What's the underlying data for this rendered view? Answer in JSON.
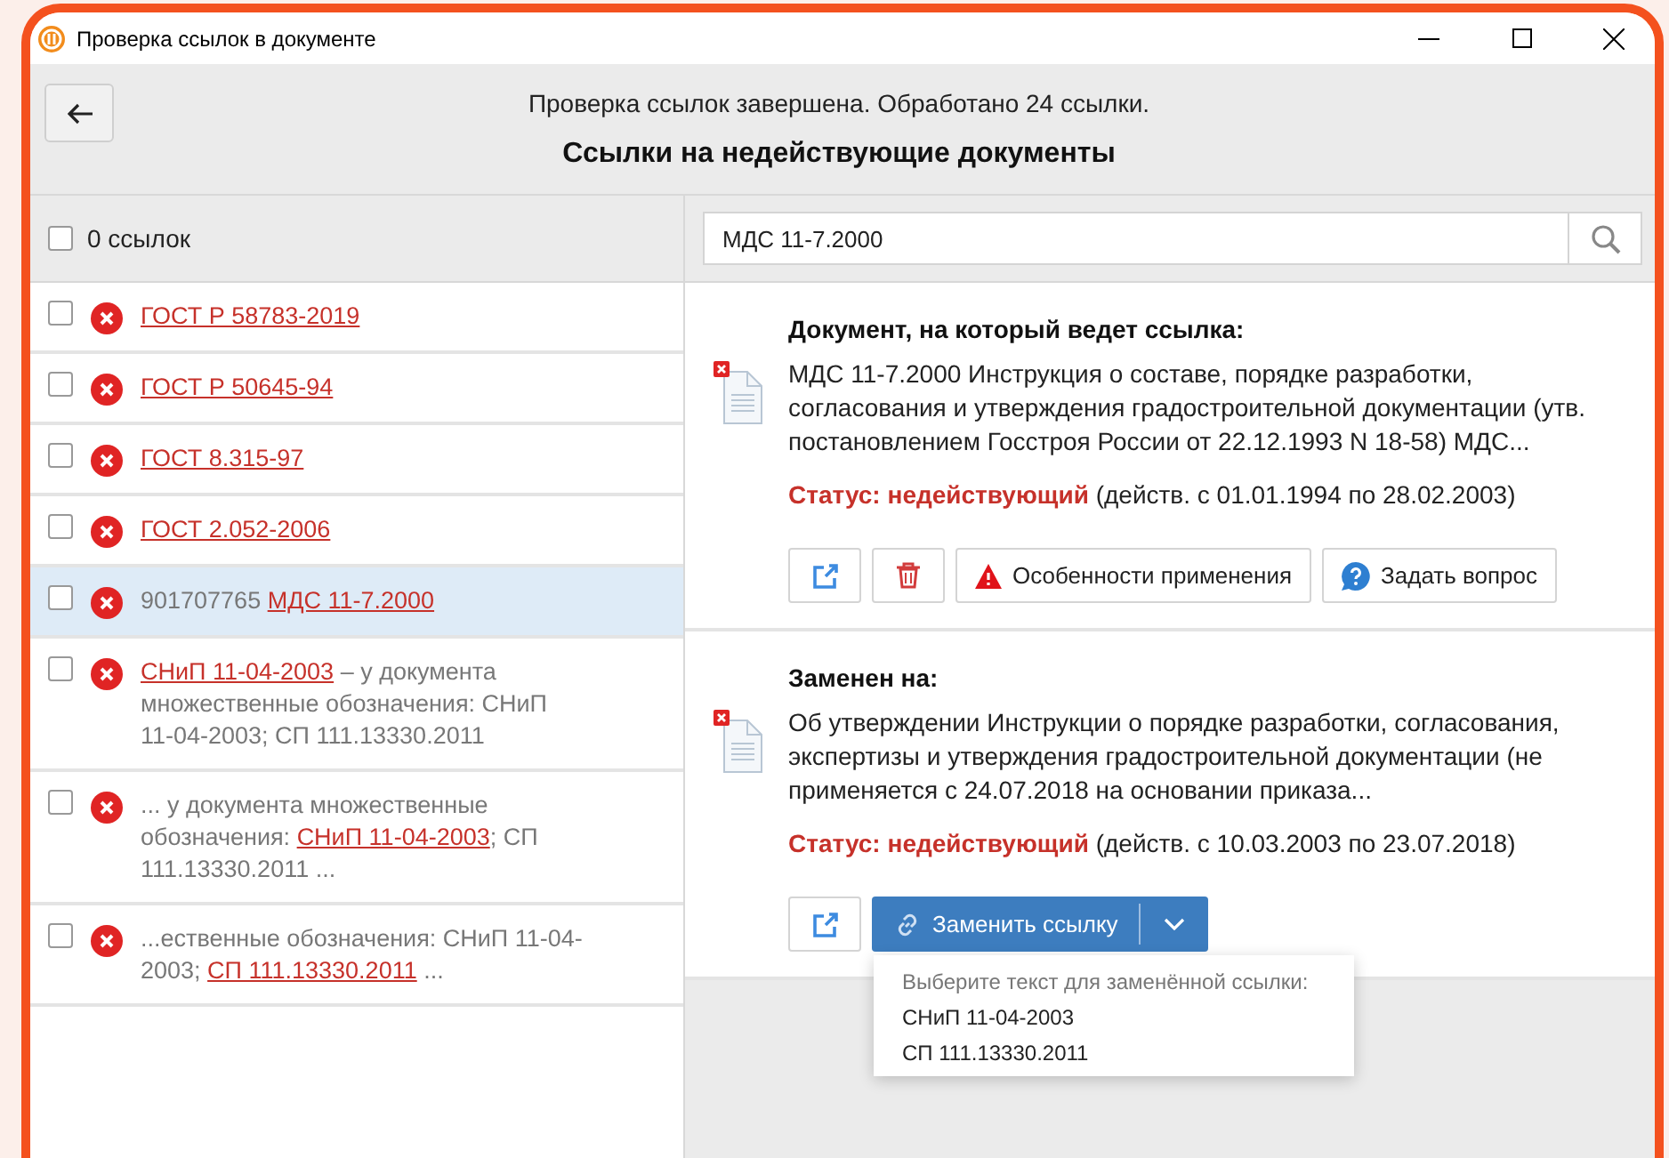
{
  "window": {
    "title": "Проверка ссылок в документе"
  },
  "header": {
    "summary": "Проверка ссылок завершена. Обработано 24 ссылки.",
    "title": "Ссылки на недействующие документы"
  },
  "list_header": {
    "checked": false,
    "label": "0 ссылок"
  },
  "search": {
    "value": "МДС 11-7.2000"
  },
  "items": [
    {
      "checked": false,
      "selected": false,
      "parts": [
        {
          "text": "ГОСТ Р 58783-2019",
          "link": true
        }
      ]
    },
    {
      "checked": false,
      "selected": false,
      "parts": [
        {
          "text": "ГОСТ Р 50645-94",
          "link": true
        }
      ]
    },
    {
      "checked": false,
      "selected": false,
      "parts": [
        {
          "text": "ГОСТ 8.315-97",
          "link": true
        }
      ]
    },
    {
      "checked": false,
      "selected": false,
      "parts": [
        {
          "text": "ГОСТ 2.052-2006",
          "link": true
        }
      ]
    },
    {
      "checked": false,
      "selected": true,
      "parts": [
        {
          "text": "901707765 ",
          "link": false
        },
        {
          "text": "МДС 11-7.2000",
          "link": true
        }
      ]
    },
    {
      "checked": false,
      "selected": false,
      "parts": [
        {
          "text": "СНиП 11-04-2003",
          "link": true
        },
        {
          "text": " – у документа множественные обозначения: СНиП 11-04-2003; СП 111.13330.2011",
          "link": false
        }
      ]
    },
    {
      "checked": false,
      "selected": false,
      "parts": [
        {
          "text": "... у документа множественные обозначения: ",
          "link": false
        },
        {
          "text": "СНиП 11-04-2003",
          "link": true
        },
        {
          "text": "; СП 111.13330.2011 ...",
          "link": false
        }
      ]
    },
    {
      "checked": false,
      "selected": false,
      "parts": [
        {
          "text": "...ественные обозначения: СНиП 11-04-2003; ",
          "link": false
        },
        {
          "text": "СП 111.13330.2011",
          "link": true
        },
        {
          "text": " ...",
          "link": false
        }
      ]
    }
  ],
  "target": {
    "heading": "Документ, на который ведет ссылка:",
    "description": "МДС 11-7.2000 Инструкция о составе, порядке разработки, согласования и утверждения градостроительной документации (утв. постановлением Госстроя России от 22.12.1993 N 18-58) МДС...",
    "status_label": "Статус: недействующий",
    "status_period": "(действ. с 01.01.1994 по 28.02.2003)",
    "actions": [
      {
        "kind": "open"
      },
      {
        "kind": "delete"
      },
      {
        "kind": "warning",
        "label": "Особенности применения"
      },
      {
        "kind": "question",
        "label": "Задать вопрос"
      }
    ]
  },
  "replacement": {
    "heading": "Заменен на:",
    "description": "Об утверждении Инструкции о порядке разработки, согласования, экспертизы и утверждения градостроительной документации (не применяется с 24.07.2018 на основании приказа...",
    "status_label": "Статус: недействующий",
    "status_period": "(действ. с 10.03.2003 по 23.07.2018)",
    "replace_button": {
      "label": "Заменить ссылку",
      "expanded": true
    },
    "menu": {
      "title": "Выберите текст для заменённой ссылки:",
      "options": [
        "СНиП 11-04-2003",
        "СП 111.13330.2011"
      ]
    }
  }
}
